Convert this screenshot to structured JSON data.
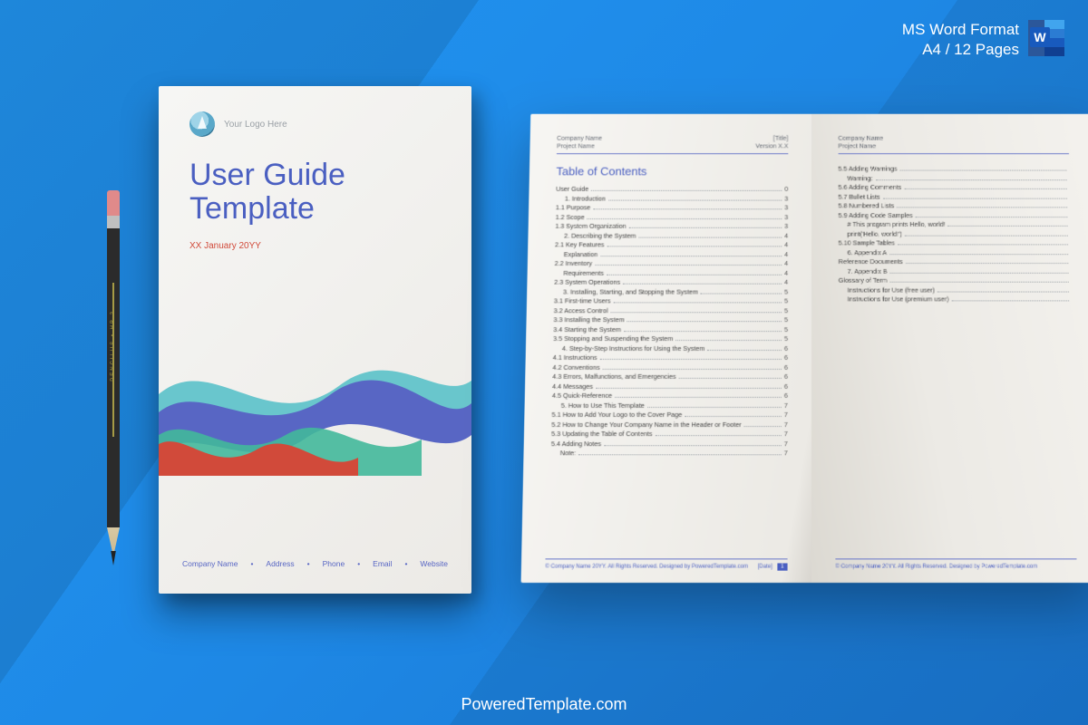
{
  "badge": {
    "line1": "MS Word Format",
    "line2": "A4 / 12 Pages",
    "icon_letter": "W"
  },
  "brand": "PoweredTemplate.com",
  "pencil_label": "PENCILUS  •  HB 2",
  "cover": {
    "logo_text": "Your Logo Here",
    "title_line1": "User Guide",
    "title_line2": "Template",
    "date": "XX January 20YY",
    "footer": [
      "Company Name",
      "Address",
      "Phone",
      "Email",
      "Website"
    ]
  },
  "page_left": {
    "hdr_l1": "Company Name",
    "hdr_r1": "[Title]",
    "hdr_l2": "Project Name",
    "hdr_r2": "Version X.X",
    "toc_title": "Table of Contents",
    "items": [
      {
        "t": "User Guide",
        "p": "0",
        "i": 0
      },
      {
        "t": "1. Introduction",
        "p": "3",
        "i": 1
      },
      {
        "t": "1.1 Purpose",
        "p": "3",
        "i": 0
      },
      {
        "t": "1.2 Scope",
        "p": "3",
        "i": 0
      },
      {
        "t": "1.3 System Organization",
        "p": "3",
        "i": 0
      },
      {
        "t": "2. Describing the System",
        "p": "4",
        "i": 1
      },
      {
        "t": "2.1 Key Features",
        "p": "4",
        "i": 0
      },
      {
        "t": "Explanation",
        "p": "4",
        "i": 1
      },
      {
        "t": "2.2 Inventory",
        "p": "4",
        "i": 0
      },
      {
        "t": "Requirements",
        "p": "4",
        "i": 1
      },
      {
        "t": "2.3 System Operations",
        "p": "4",
        "i": 0
      },
      {
        "t": "3. Installing, Starting, and Stopping the System",
        "p": "5",
        "i": 1
      },
      {
        "t": "3.1 First-time Users",
        "p": "5",
        "i": 0
      },
      {
        "t": "3.2 Access Control",
        "p": "5",
        "i": 0
      },
      {
        "t": "3.3 Installing the System",
        "p": "5",
        "i": 0
      },
      {
        "t": "3.4 Starting the System",
        "p": "5",
        "i": 0
      },
      {
        "t": "3.5 Stopping and Suspending the System",
        "p": "5",
        "i": 0
      },
      {
        "t": "4. Step-by-Step Instructions for Using the System",
        "p": "6",
        "i": 1
      },
      {
        "t": "4.1 Instructions",
        "p": "6",
        "i": 0
      },
      {
        "t": "4.2 Conventions",
        "p": "6",
        "i": 0
      },
      {
        "t": "4.3 Errors, Malfunctions, and Emergencies",
        "p": "6",
        "i": 0
      },
      {
        "t": "4.4 Messages",
        "p": "6",
        "i": 0
      },
      {
        "t": "4.5 Quick-Reference",
        "p": "6",
        "i": 0
      },
      {
        "t": "5. How to Use This Template",
        "p": "7",
        "i": 1
      },
      {
        "t": "5.1 How to Add Your Logo to the Cover Page",
        "p": "7",
        "i": 0
      },
      {
        "t": "5.2 How to Change Your Company Name in the Header or Footer",
        "p": "7",
        "i": 0
      },
      {
        "t": "5.3 Updating the Table of Contents",
        "p": "7",
        "i": 0
      },
      {
        "t": "5.4 Adding Notes",
        "p": "7",
        "i": 0
      },
      {
        "t": "Note:",
        "p": "7",
        "i": 1
      }
    ],
    "ftr_copyright": "© Company Name 20YY. All Rights Reserved. Designed by PoweredTemplate.com",
    "ftr_date": "[Date]",
    "ftr_page": "1"
  },
  "page_right": {
    "hdr_l1": "Company Name",
    "hdr_l2": "Project Name",
    "items": [
      {
        "t": "5.5 Adding Warnings",
        "i": 0
      },
      {
        "t": "Warning:",
        "i": 1
      },
      {
        "t": "5.6 Adding Comments",
        "i": 0
      },
      {
        "t": "5.7 Bullet Lists",
        "i": 0
      },
      {
        "t": "5.8 Numbered Lists",
        "i": 0
      },
      {
        "t": "5.9 Adding Code Samples",
        "i": 0
      },
      {
        "t": "# This program prints Hello, world!",
        "i": 1
      },
      {
        "t": "print('Hello, world!')",
        "i": 1
      },
      {
        "t": "5.10 Sample Tables",
        "i": 0
      },
      {
        "t": "6. Appendix A",
        "i": 1
      },
      {
        "t": "Reference Documents",
        "i": 0
      },
      {
        "t": "7. Appendix B",
        "i": 1
      },
      {
        "t": "Glossary of Term",
        "i": 0
      },
      {
        "t": "Instructions for Use (free user)",
        "i": 1
      },
      {
        "t": "Instructions for Use (premium user)",
        "i": 1
      }
    ],
    "ftr_copyright": "© Company Name 20YY. All Rights Reserved. Designed by PoweredTemplate.com"
  }
}
